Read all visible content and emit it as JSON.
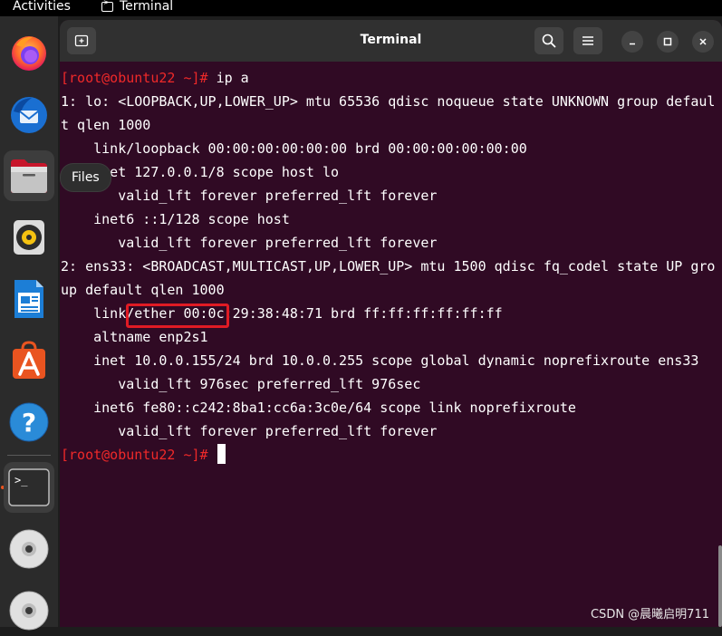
{
  "topbar": {
    "activities": "Activities",
    "app_name": "Terminal"
  },
  "dock": {
    "tooltip": "Files",
    "items": [
      {
        "name": "firefox-icon"
      },
      {
        "name": "thunderbird-icon"
      },
      {
        "name": "files-icon"
      },
      {
        "name": "rhythmbox-icon"
      },
      {
        "name": "libreoffice-writer-icon"
      },
      {
        "name": "app-center-icon"
      },
      {
        "name": "help-icon"
      },
      {
        "name": "terminal-icon"
      },
      {
        "name": "disc-icon"
      },
      {
        "name": "disc-icon"
      }
    ]
  },
  "window": {
    "title": "Terminal"
  },
  "terminal": {
    "lines": [
      {
        "prompt": "[root@obuntu22 ~]#",
        "text": " ip a"
      },
      {
        "text": "1: lo: <LOOPBACK,UP,LOWER_UP> mtu 65536 qdisc noqueue state UNKNOWN group defaul"
      },
      {
        "text": "t qlen 1000"
      },
      {
        "text": "    link/loopback 00:00:00:00:00:00 brd 00:00:00:00:00:00"
      },
      {
        "text": "    inet 127.0.0.1/8 scope host lo"
      },
      {
        "text": "       valid_lft forever preferred_lft forever"
      },
      {
        "text": "    inet6 ::1/128 scope host"
      },
      {
        "text": "       valid_lft forever preferred_lft forever"
      },
      {
        "text": "2: ens33: <BROADCAST,MULTICAST,UP,LOWER_UP> mtu 1500 qdisc fq_codel state UP gro"
      },
      {
        "text": "up default qlen 1000"
      },
      {
        "text": "    link/ether 00:0c:29:38:48:71 brd ff:ff:ff:ff:ff:ff"
      },
      {
        "text": "    altname enp2s1"
      },
      {
        "text": "    inet 10.0.0.155/24 brd 10.0.0.255 scope global dynamic noprefixroute ens33"
      },
      {
        "text": "       valid_lft 976sec preferred_lft 976sec"
      },
      {
        "text": "    inet6 fe80::c242:8ba1:cc6a:3c0e/64 scope link noprefixroute"
      },
      {
        "text": "       valid_lft forever preferred_lft forever"
      },
      {
        "prompt": "[root@obuntu22 ~]#",
        "text": " ",
        "cursor": true
      }
    ]
  },
  "watermark": "CSDN @晨曦启明711",
  "colors": {
    "terminal_bg": "#300a24",
    "prompt": "#ef2929",
    "highlight_box": "#e01b24",
    "accent": "#e95420"
  }
}
